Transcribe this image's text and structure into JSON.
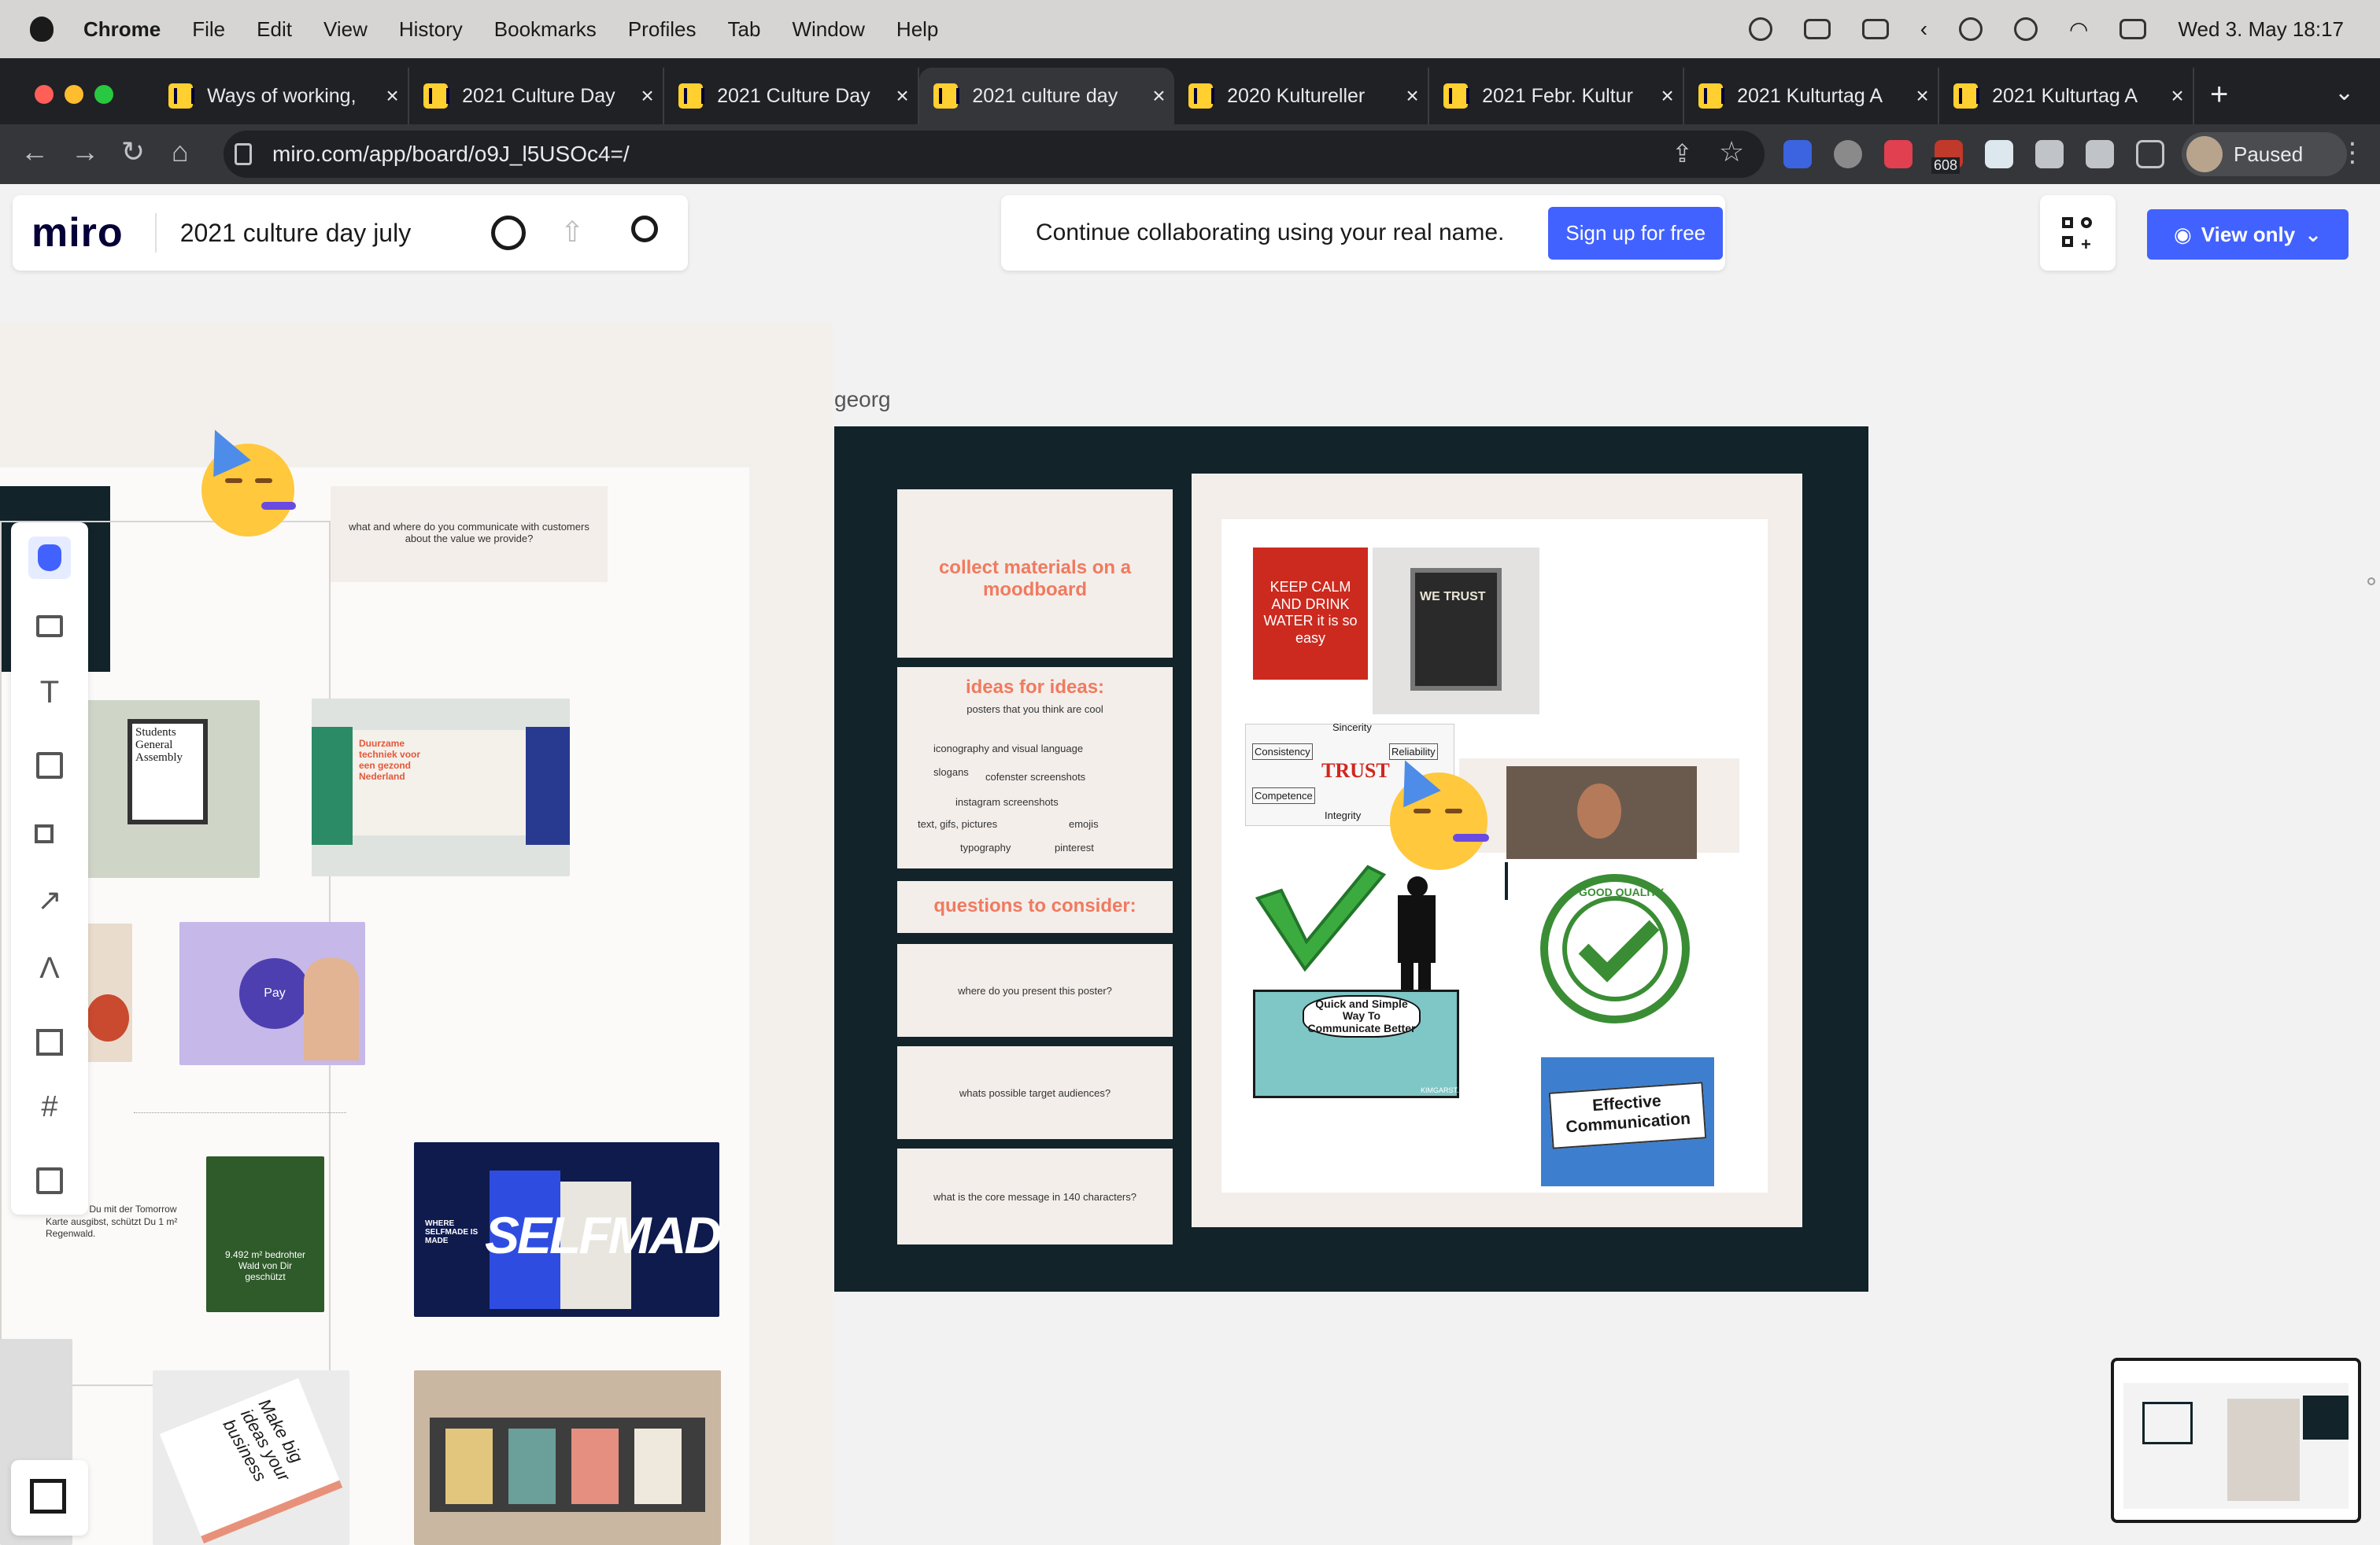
{
  "macos_menu": {
    "app": "Chrome",
    "items": [
      "File",
      "Edit",
      "View",
      "History",
      "Bookmarks",
      "Profiles",
      "Tab",
      "Window",
      "Help"
    ],
    "clock": "Wed 3. May  18:17"
  },
  "tabs": [
    {
      "title": "Ways of working,"
    },
    {
      "title": "2021 Culture Day"
    },
    {
      "title": "2021 Culture Day"
    },
    {
      "title": "2021 culture day"
    },
    {
      "title": "2020 Kultureller"
    },
    {
      "title": "2021 Febr. Kultur"
    },
    {
      "title": "2021 Kulturtag A"
    },
    {
      "title": "2021 Kulturtag A"
    }
  ],
  "address_bar": {
    "url": "miro.com/app/board/o9J_l5USOc4=/"
  },
  "extensions": {
    "badge": "608"
  },
  "profile": {
    "label": "Paused"
  },
  "miro": {
    "logo": "miro",
    "board_name": "2021 culture day july",
    "banner_text": "Continue collaborating using your real name.",
    "signup_label": "Sign up for free",
    "view_only_label": "View only"
  },
  "board": {
    "left_card_text": "what and where do you communicate with customers about the value we provide?",
    "poster_students": "Students General Assembly",
    "poster_dutch": "Duurzame techniek voor een gezond Nederland",
    "pay_label": "Pay",
    "forest_text": "9.492 m² bedrohter Wald von Dir geschützt",
    "rainforest_text": "Euro, den Du mit der Tomorrow Karte ausgibst, schützt Du 1 m² Regenwald.",
    "selfmade_text": "SELFMADE",
    "selfmade_small": "WHERE SELFMADE IS MADE",
    "cards_text": "Make big ideas your business",
    "frame_label": "georg",
    "collect": "collect materials on a moodboard",
    "ideas_title": "ideas for ideas:",
    "ideas_sub": "posters that you think are cool",
    "ideas_items": [
      "iconography and visual language",
      "slogans",
      "cofenster screenshots",
      "instagram screenshots",
      "text, gifs, pictures",
      "emojis",
      "typography",
      "pinterest"
    ],
    "questions_title": "questions to consider:",
    "q1": "where do you present this poster?",
    "q2": "whats possible target audiences?",
    "q3": "what is the core message in 140 characters?",
    "mood_keepcalm": "KEEP CALM AND DRINK WATER it is so easy",
    "mood_trust": "WE TRUST",
    "mood_trust_words": [
      "Sincerity",
      "Consistency",
      "Reliability",
      "TRUST",
      "Competence",
      "Integrity"
    ],
    "mood_communicate": "Quick and Simple Way To Communicate Better",
    "mood_quality": "GOOD QUALITY",
    "mood_effective": "Effective Communication",
    "mood_kimgarst": "KIMGARST.COM"
  }
}
